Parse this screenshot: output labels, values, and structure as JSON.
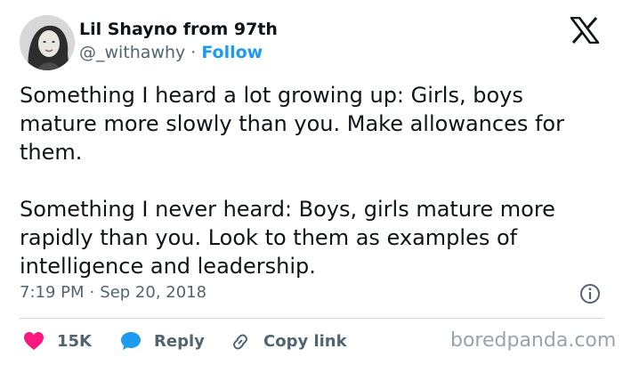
{
  "author": {
    "name": "Lil Shayno from 97th",
    "handle": "@_withawhy",
    "separator": "·",
    "follow_label": "Follow"
  },
  "tweet": {
    "paragraphs": [
      "Something I heard a lot growing up: Girls, boys mature more slowly than you. Make allowances for them.",
      "Something I never heard: Boys, girls mature more rapidly than you. Look to them as examples of intelligence and leadership."
    ],
    "time": "7:19 PM",
    "date": "Sep 20, 2018"
  },
  "actions": {
    "like_count": "15K",
    "reply_label": "Reply",
    "copy_label": "Copy link"
  },
  "watermark": "boredpanda.com",
  "colors": {
    "like": "#f91880",
    "reply": "#1d9bf0",
    "link": "#1d9bf0",
    "muted": "#536471"
  },
  "icons": {
    "brand": "x-logo-icon",
    "info": "info-icon",
    "like": "heart-icon",
    "reply": "speech-bubble-icon",
    "copy": "link-icon"
  }
}
